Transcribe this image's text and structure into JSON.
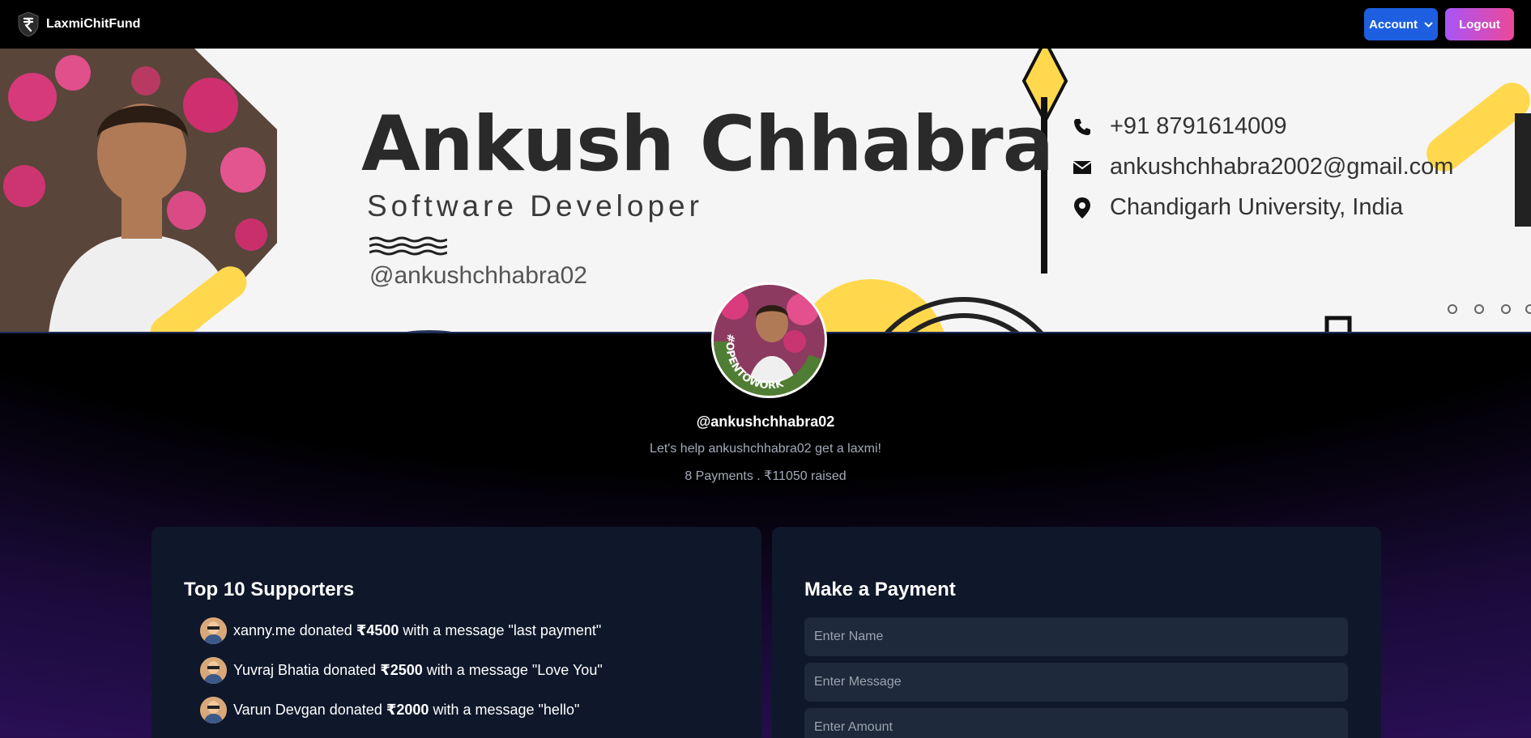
{
  "navbar": {
    "brand": "LaxmiChitFund",
    "brand_icon": "rupee-shield-icon",
    "account_label": "Account",
    "logout_label": "Logout"
  },
  "cover": {
    "name": "Ankush Chhabra",
    "role": "Software Developer",
    "handle": "@ankushchhabra02",
    "phone": "+91 8791614009",
    "email": "ankushchhabra2002@gmail.com",
    "location": "Chandigarh University, India"
  },
  "profile": {
    "avatar_badge": "#OPENTOWORK",
    "handle": "@ankushchhabra02",
    "tagline": "Let's help ankushchhabra02 get a laxmi!",
    "stats": "8 Payments . ₹11050 raised"
  },
  "supporters": {
    "title": "Top 10 Supporters",
    "items": [
      {
        "name": "xanny.me",
        "amount": "₹4500",
        "message": "\"last payment\""
      },
      {
        "name": "Yuvraj Bhatia",
        "amount": "₹2500",
        "message": "\"Love You\""
      },
      {
        "name": "Varun Devgan",
        "amount": "₹2000",
        "message": "\"hello\""
      }
    ],
    "donated_word": "donated",
    "with_message_text": "with a message"
  },
  "payment": {
    "title": "Make a Payment",
    "name_placeholder": "Enter Name",
    "message_placeholder": "Enter Message",
    "amount_placeholder": "Enter Amount"
  },
  "colors": {
    "account_button": "#1d5fe0",
    "logout_gradient_start": "#a855f7",
    "logout_gradient_end": "#ec4899",
    "panel_bg": "#0f172a",
    "field_bg": "#1e293b"
  }
}
